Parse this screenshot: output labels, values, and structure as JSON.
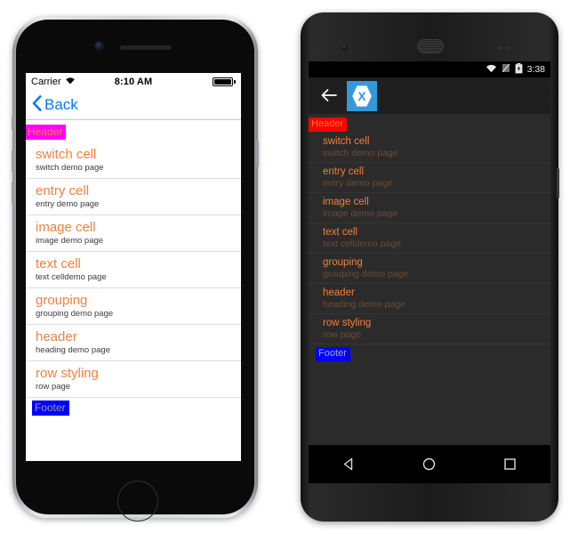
{
  "ios": {
    "status": {
      "carrier": "Carrier",
      "time": "8:10 AM",
      "wifi_icon": "wifi-icon",
      "battery_icon": "battery-full-icon"
    },
    "nav": {
      "back_label": "Back",
      "back_icon": "chevron-left-icon"
    },
    "list": {
      "header": "Header",
      "footer": "Footer",
      "rows": [
        {
          "title": "switch cell",
          "detail": "switch demo page"
        },
        {
          "title": "entry cell",
          "detail": "entry demo page"
        },
        {
          "title": "image cell",
          "detail": "image demo page"
        },
        {
          "title": "text cell",
          "detail": "text celldemo page"
        },
        {
          "title": "grouping",
          "detail": "grouping demo page"
        },
        {
          "title": "header",
          "detail": "heading demo page"
        },
        {
          "title": "row styling",
          "detail": "row page"
        }
      ]
    },
    "colors": {
      "header_bg": "#ff00ff",
      "footer_bg": "#0000ff",
      "title": "#f08040",
      "accent": "#007aff"
    }
  },
  "android": {
    "status": {
      "time": "3:38",
      "wifi_icon": "wifi-icon",
      "signal_icon": "no-signal-icon",
      "battery_icon": "battery-charging-icon"
    },
    "action": {
      "back_icon": "arrow-left-icon",
      "logo_icon": "xamarin-logo-icon"
    },
    "list": {
      "header": "Header",
      "footer": "Footer",
      "rows": [
        {
          "title": "switch cell",
          "detail": "switch demo page"
        },
        {
          "title": "entry cell",
          "detail": "entry demo page"
        },
        {
          "title": "image cell",
          "detail": "image demo page"
        },
        {
          "title": "text cell",
          "detail": "text celldemo page"
        },
        {
          "title": "grouping",
          "detail": "grouping demo page"
        },
        {
          "title": "header",
          "detail": "heading demo page"
        },
        {
          "title": "row styling",
          "detail": "row page"
        }
      ]
    },
    "navbar": {
      "back_icon": "triangle-back-icon",
      "home_icon": "circle-home-icon",
      "recents_icon": "square-recents-icon"
    },
    "colors": {
      "header_bg": "#ff0000",
      "footer_bg": "#0000ff",
      "title": "#f08040",
      "logo_bg": "#3498db"
    }
  }
}
